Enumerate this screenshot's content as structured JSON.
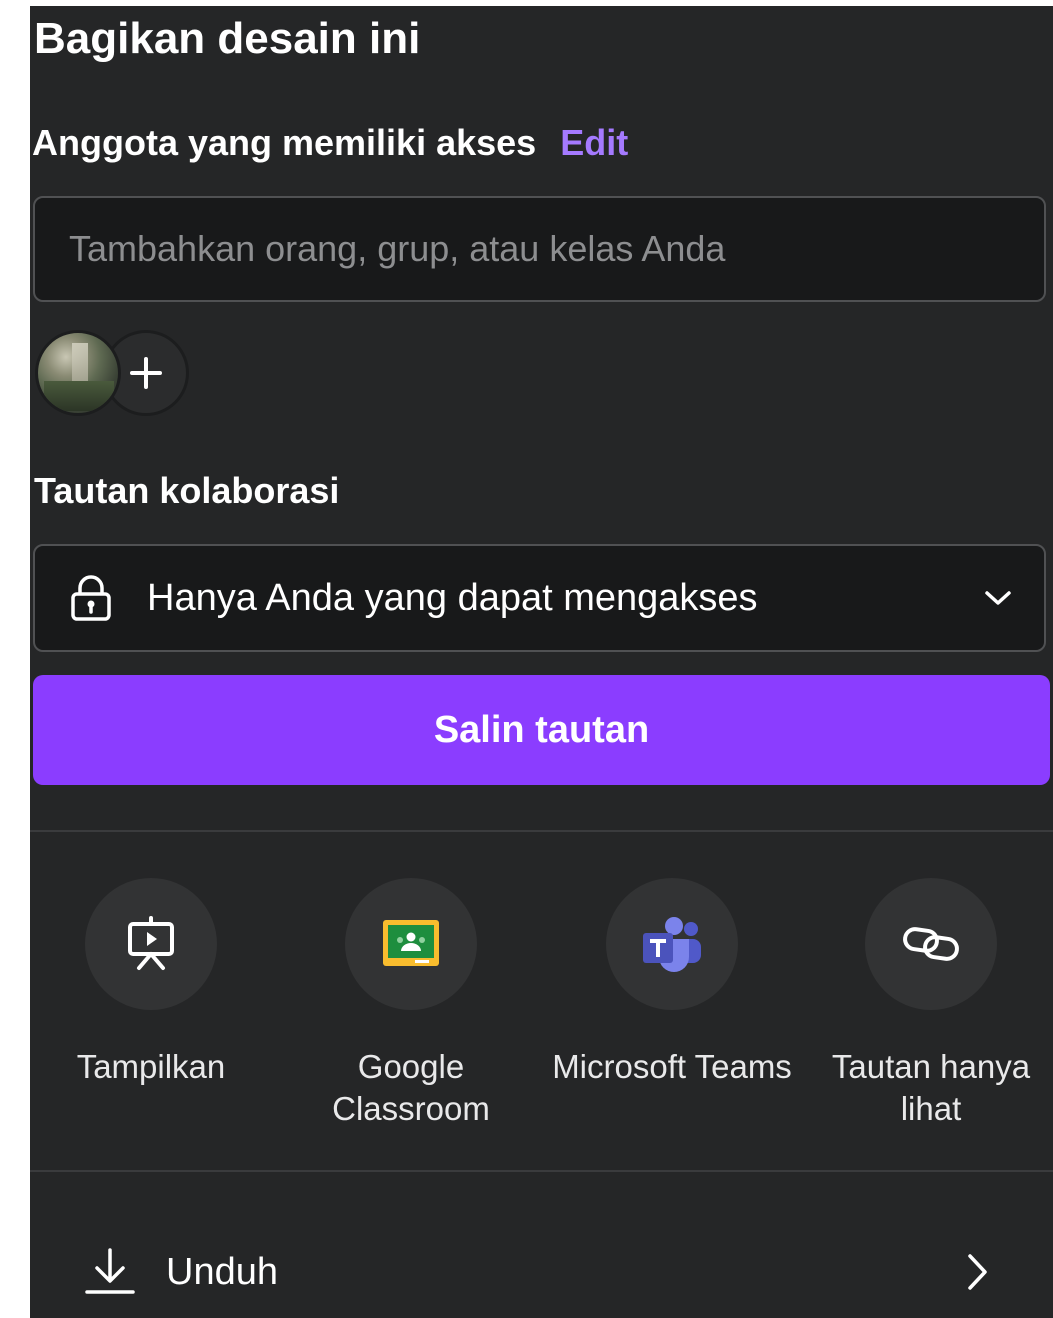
{
  "header": {
    "title": "Bagikan desain ini"
  },
  "members": {
    "label": "Anggota yang memiliki akses",
    "edit_label": "Edit",
    "search_placeholder": "Tambahkan orang, grup, atau kelas Anda",
    "add_icon": "plus-icon"
  },
  "collaboration": {
    "label": "Tautan kolaborasi",
    "access_value": "Hanya Anda yang dapat mengakses",
    "access_icon": "lock-icon",
    "copy_button": "Salin tautan"
  },
  "share_options": [
    {
      "label": "Tampilkan",
      "icon": "present-icon"
    },
    {
      "label": "Google Classroom",
      "icon": "google-classroom-icon"
    },
    {
      "label": "Microsoft Teams",
      "icon": "microsoft-teams-icon"
    },
    {
      "label": "Tautan hanya lihat",
      "icon": "link-icon"
    }
  ],
  "download": {
    "label": "Unduh",
    "icon": "download-icon"
  },
  "colors": {
    "panel_background": "#252627",
    "accent": "#8b3dff",
    "edit_link": "#a57aff"
  }
}
